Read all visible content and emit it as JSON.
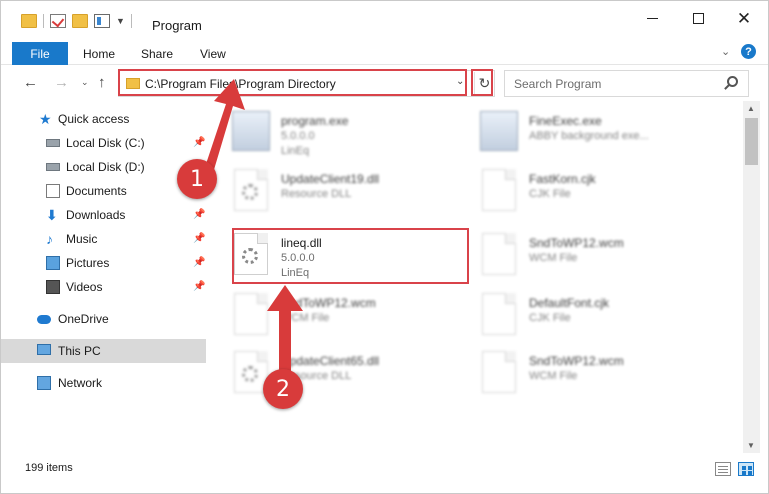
{
  "window": {
    "title": "Program"
  },
  "ribbon": {
    "file_label": "File",
    "home_label": "Home",
    "share_label": "Share",
    "view_label": "View",
    "help_label": "?"
  },
  "address": {
    "path": "C:\\Program Files\\Program Directory"
  },
  "search": {
    "placeholder": "Search Program"
  },
  "navpane": {
    "items": [
      {
        "label": "Quick access",
        "icon": "star-icon",
        "pinned": false
      },
      {
        "label": "Local Disk (C:)",
        "icon": "disk-icon",
        "pinned": true
      },
      {
        "label": "Local Disk (D:)",
        "icon": "disk-icon",
        "pinned": false
      },
      {
        "label": "Documents",
        "icon": "documents-icon",
        "pinned": true
      },
      {
        "label": "Downloads",
        "icon": "download-icon",
        "pinned": true
      },
      {
        "label": "Music",
        "icon": "music-icon",
        "pinned": true
      },
      {
        "label": "Pictures",
        "icon": "pictures-icon",
        "pinned": true
      },
      {
        "label": "Videos",
        "icon": "videos-icon",
        "pinned": true
      },
      {
        "label": "OneDrive",
        "icon": "cloud-icon",
        "pinned": false
      },
      {
        "label": "This PC",
        "icon": "computer-icon",
        "pinned": false,
        "selected": true
      },
      {
        "label": "Network",
        "icon": "network-icon",
        "pinned": false
      }
    ]
  },
  "files": [
    {
      "name": "program.exe",
      "line1": "5.0.0.0",
      "line2": "LinEq",
      "icon": "exe-icon"
    },
    {
      "name": "FineExec.exe",
      "line1": "ABBY background exe...",
      "line2": "",
      "icon": "exe-icon"
    },
    {
      "name": "UpdateClient19.dll",
      "line1": "Resource DLL",
      "line2": "",
      "icon": "dll-icon"
    },
    {
      "name": "FastKorn.cjk",
      "line1": "CJK File",
      "line2": "",
      "icon": "file-icon"
    },
    {
      "name": "lineq.dll",
      "line1": "5.0.0.0",
      "line2": "LinEq",
      "icon": "dll-icon",
      "highlighted": true
    },
    {
      "name": "SndToWP12.wcm",
      "line1": "WCM File",
      "line2": "",
      "icon": "file-icon"
    },
    {
      "name": "SndToWP12.wcm",
      "line1": "WCM File",
      "line2": "",
      "icon": "file-icon"
    },
    {
      "name": "DefaultFont.cjk",
      "line1": "CJK File",
      "line2": "",
      "icon": "file-icon"
    },
    {
      "name": "UpdateClient65.dll",
      "line1": "Resource DLL",
      "line2": "",
      "icon": "dll-icon"
    },
    {
      "name": "SndToWP12.wcm",
      "line1": "WCM File",
      "line2": "",
      "icon": "file-icon"
    }
  ],
  "annotations": {
    "step1": "1",
    "step2": "2",
    "color": "#d83b3b"
  },
  "status": {
    "item_count": "199 items"
  },
  "colors": {
    "accent": "#1979ca",
    "highlight_border": "#d9434a",
    "selected_bg": "#d9d9d9"
  }
}
